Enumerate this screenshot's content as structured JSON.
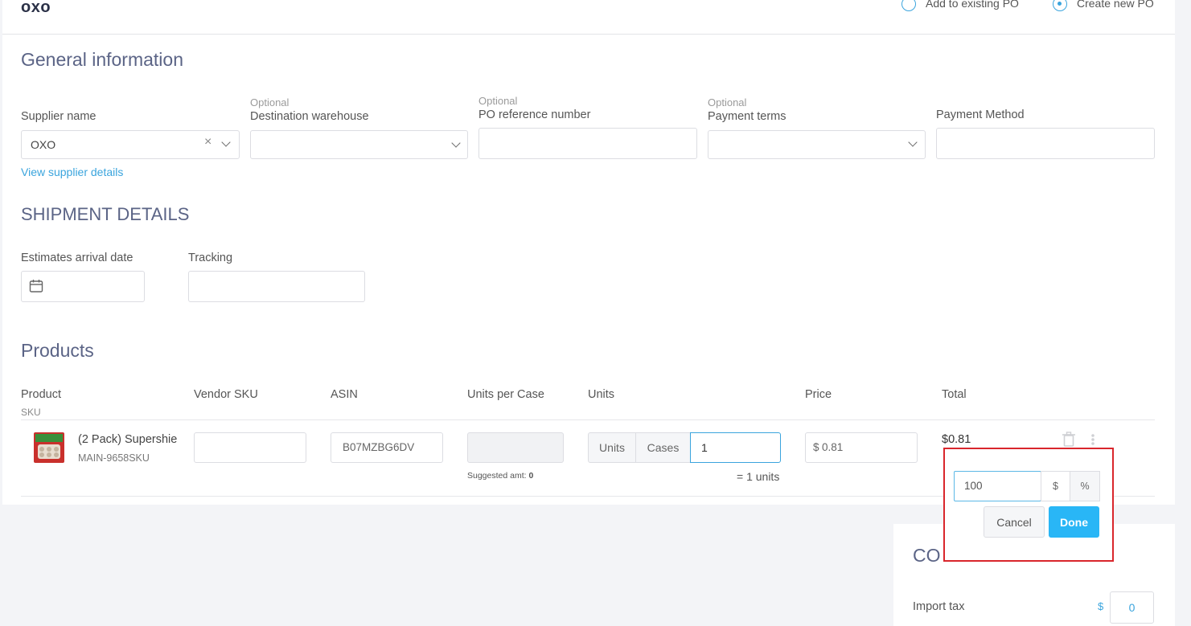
{
  "header": {
    "supplier_title": "oxo",
    "radio_existing_label": "Add to existing PO",
    "radio_new_label": "Create new PO"
  },
  "general": {
    "title": "General information",
    "supplier_label": "Supplier name",
    "supplier_value": "OXO",
    "supplier_clear": "×",
    "view_supplier_link": "View supplier details",
    "warehouse_optional": "Optional",
    "warehouse_label": "Destination warehouse",
    "po_ref_optional": "Optional",
    "po_ref_label": "PO reference number",
    "payment_terms_optional": "Optional",
    "payment_terms_label": "Payment terms",
    "payment_method_label": "Payment Method"
  },
  "shipment": {
    "title": "SHIPMENT DETAILS",
    "arrival_label": "Estimates arrival date",
    "tracking_label": "Tracking"
  },
  "products": {
    "title": "Products",
    "columns": {
      "product": "Product",
      "sku": "SKU",
      "vendor_sku": "Vendor SKU",
      "asin": "ASIN",
      "units_per_case": "Units per Case",
      "units": "Units",
      "price": "Price",
      "total": "Total"
    },
    "row": {
      "name": "(2 Pack) Supershie",
      "sku": "MAIN-9658SKU",
      "asin": "B07MZBG6DV",
      "suggested_label": "Suggested amt:",
      "suggested_value": "0",
      "units_toggle": "Units",
      "cases_toggle": "Cases",
      "quantity": "1",
      "units_equiv": "= 1 units",
      "price_currency": "$",
      "price_value": "0.81",
      "total": "$0.81"
    }
  },
  "popup": {
    "value": "100",
    "dollar_toggle": "$",
    "percent_toggle": "%",
    "cancel_label": "Cancel",
    "done_label": "Done"
  },
  "costs": {
    "title_partial": "CO",
    "import_tax_label": "Import tax",
    "import_tax_currency": "$",
    "import_tax_value": "0"
  },
  "colors": {
    "accent": "#3aa4dd",
    "done_button": "#29b6f6",
    "highlight_border": "#d9262c",
    "section_title": "#5b6486"
  }
}
